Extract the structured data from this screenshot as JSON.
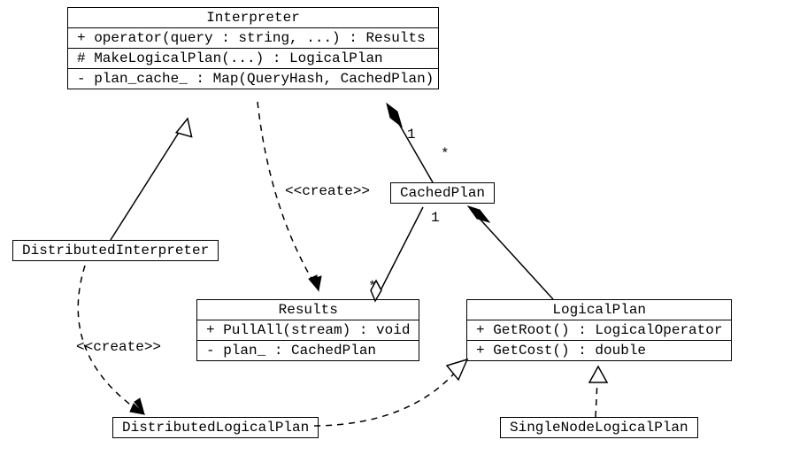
{
  "classes": {
    "interpreter": {
      "name": "Interpreter",
      "rows": [
        "+ operator(query : string, ...) : Results",
        "# MakeLogicalPlan(...) : LogicalPlan",
        "- plan_cache_ : Map(QueryHash, CachedPlan)"
      ]
    },
    "distributedInterpreter": {
      "name": "DistributedInterpreter"
    },
    "cachedPlan": {
      "name": "CachedPlan"
    },
    "results": {
      "name": "Results",
      "rows": [
        "+ PullAll(stream) : void",
        "- plan_ : CachedPlan"
      ]
    },
    "logicalPlan": {
      "name": "LogicalPlan",
      "rows": [
        "+ GetRoot() : LogicalOperator",
        "+ GetCost() : double"
      ]
    },
    "distributedLogicalPlan": {
      "name": "DistributedLogicalPlan"
    },
    "singleNodeLogicalPlan": {
      "name": "SingleNodeLogicalPlan"
    }
  },
  "stereotypes": {
    "createResults": "<<create>>",
    "createDlp": "<<create>>"
  },
  "multiplicities": {
    "interpCP_one": "1",
    "interpCP_many": "*",
    "cpResults_one": "1",
    "cpResults_many": "*"
  }
}
